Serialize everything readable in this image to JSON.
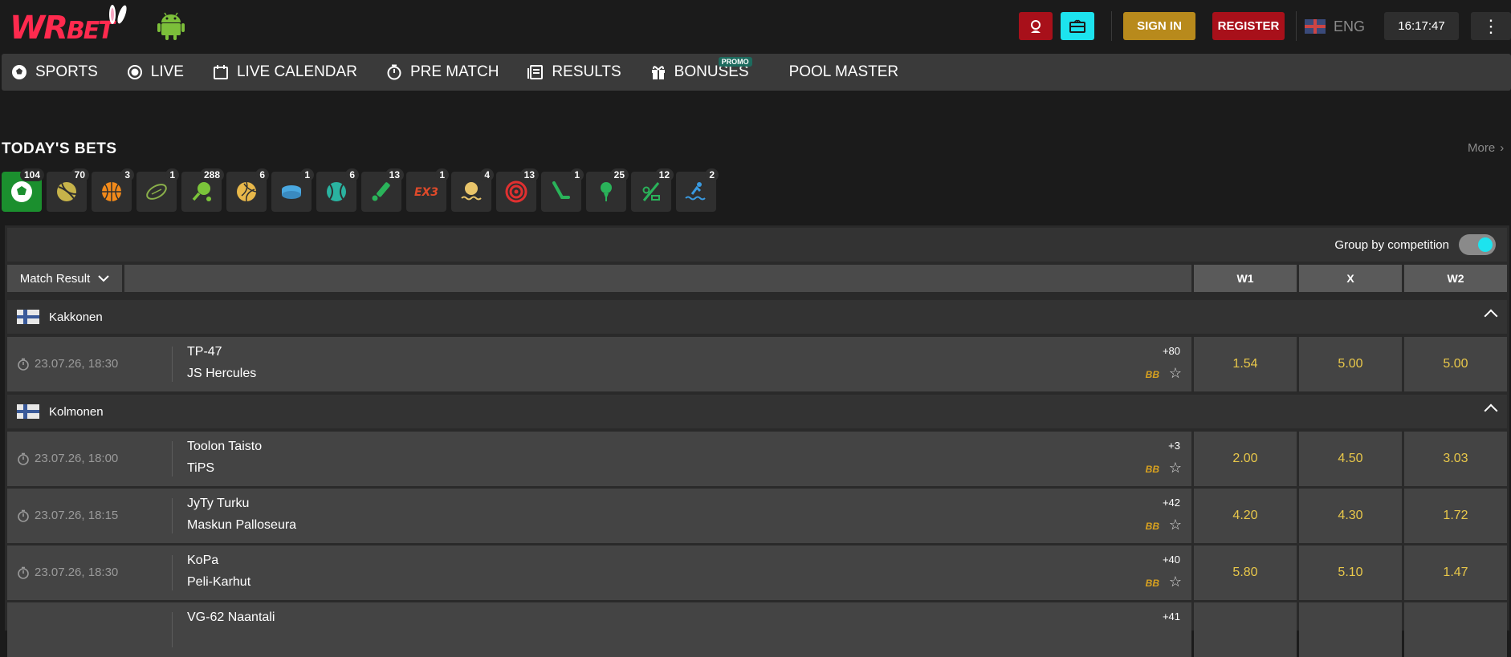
{
  "header": {
    "logo_text_a": "WR",
    "logo_text_b": "BET",
    "signin_label": "SIGN IN",
    "register_label": "REGISTER",
    "language": "ENG",
    "time": "16:17:47"
  },
  "nav": {
    "items": [
      {
        "label": "SPORTS",
        "icon": "soccer-ball-icon"
      },
      {
        "label": "LIVE",
        "icon": "live-icon"
      },
      {
        "label": "LIVE CALENDAR",
        "icon": "calendar-icon"
      },
      {
        "label": "PRE MATCH",
        "icon": "stopwatch-icon"
      },
      {
        "label": "RESULTS",
        "icon": "results-icon"
      },
      {
        "label": "BONUSES",
        "icon": "gift-icon"
      },
      {
        "label": "POOL MASTER",
        "icon": ""
      }
    ],
    "promo_badge": "PROMO"
  },
  "todays_bets": {
    "title": "TODAY'S BETS",
    "more_label": "More",
    "sports": [
      {
        "icon": "soccer-icon",
        "count": "104",
        "color": "#ffffff"
      },
      {
        "icon": "tennis-icon",
        "count": "70",
        "color": "#c6b34a"
      },
      {
        "icon": "basketball-icon",
        "count": "3",
        "color": "#f28a1a"
      },
      {
        "icon": "rugby-icon",
        "count": "1",
        "color": "#8ab04a"
      },
      {
        "icon": "table-tennis-icon",
        "count": "288",
        "color": "#7bc43a"
      },
      {
        "icon": "volleyball-icon",
        "count": "6",
        "color": "#e8b84a"
      },
      {
        "icon": "ice-hockey-icon",
        "count": "1",
        "color": "#4aa8e0"
      },
      {
        "icon": "tennis-ball-icon",
        "count": "6",
        "color": "#2ab3a0"
      },
      {
        "icon": "cricket-icon",
        "count": "13",
        "color": "#2ab35a"
      },
      {
        "icon": "3x3-basketball-icon",
        "count": "1",
        "color": "#e04a2a"
      },
      {
        "icon": "beach-volleyball-icon",
        "count": "4",
        "color": "#e8c46a"
      },
      {
        "icon": "darts-icon",
        "count": "13",
        "color": "#e03030"
      },
      {
        "icon": "hockey-stick-icon",
        "count": "1",
        "color": "#2ab35a"
      },
      {
        "icon": "golf-icon",
        "count": "25",
        "color": "#2ab35a"
      },
      {
        "icon": "baseball-icon",
        "count": "12",
        "color": "#2ab35a"
      },
      {
        "icon": "water-polo-icon",
        "count": "2",
        "color": "#3a9ae0"
      }
    ]
  },
  "table": {
    "group_label": "Group by competition",
    "market": "Match Result",
    "columns": [
      "W1",
      "X",
      "W2"
    ],
    "leagues": [
      {
        "name": "Kakkonen",
        "matches": [
          {
            "time": "23.07.26, 18:30",
            "team1": "TP-47",
            "team2": "JS Hercules",
            "more": "+80",
            "odds": [
              "1.54",
              "5.00",
              "5.00"
            ]
          }
        ]
      },
      {
        "name": "Kolmonen",
        "matches": [
          {
            "time": "23.07.26, 18:00",
            "team1": "Toolon Taisto",
            "team2": "TiPS",
            "more": "+3",
            "odds": [
              "2.00",
              "4.50",
              "3.03"
            ]
          },
          {
            "time": "23.07.26, 18:15",
            "team1": "JyTy Turku",
            "team2": "Maskun Palloseura",
            "more": "+42",
            "odds": [
              "4.20",
              "4.30",
              "1.72"
            ]
          },
          {
            "time": "23.07.26, 18:30",
            "team1": "KoPa",
            "team2": "Peli-Karhut",
            "more": "+40",
            "odds": [
              "5.80",
              "5.10",
              "1.47"
            ]
          },
          {
            "time": "",
            "team1": "VG-62 Naantali",
            "team2": "",
            "more": "+41",
            "odds": [
              "",
              "",
              ""
            ]
          }
        ]
      }
    ],
    "bb_label": "BB"
  }
}
